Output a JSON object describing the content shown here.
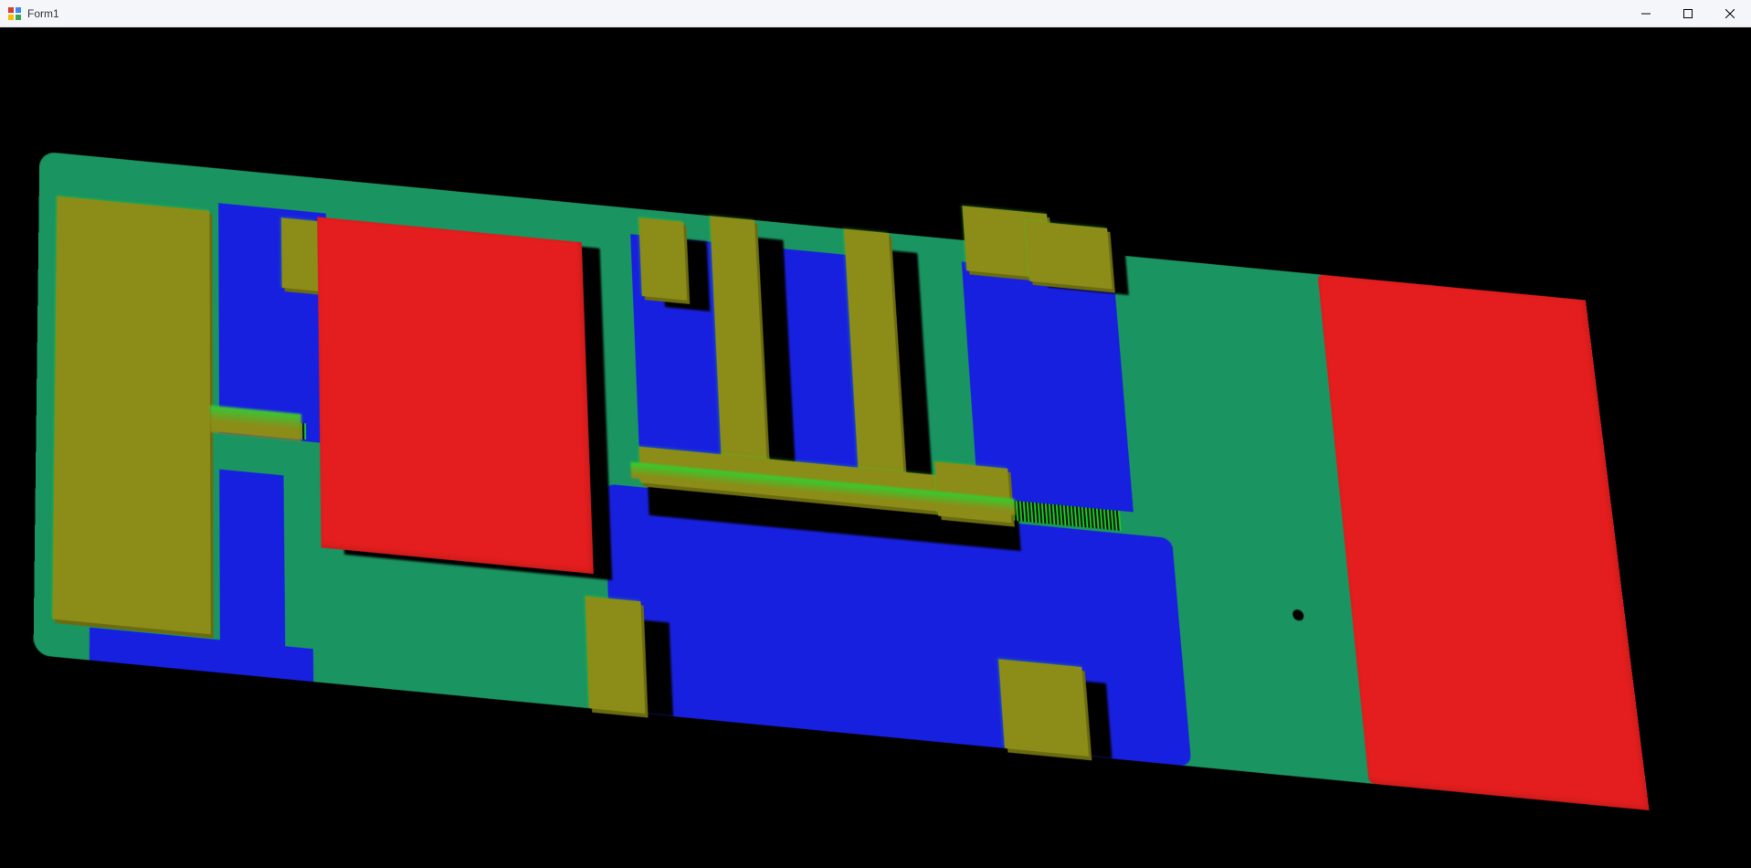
{
  "window": {
    "title": "Form1"
  },
  "viewport": {
    "background": "#000000",
    "colors": {
      "substrate": "#1a9460",
      "recess": "#1820e0",
      "component_raised": "#8c8c18",
      "chip": "#e41e1e",
      "edge_highlight": "#20d020"
    },
    "description": "3D point-cloud / depth-color rendering of a PCB-like board viewed at an oblique angle. Green base substrate, blue recessed regions, olive/dark-yellow raised components including a trident-shaped structure, two large red rectangular chips, bright-green speckled edges on height transitions."
  }
}
